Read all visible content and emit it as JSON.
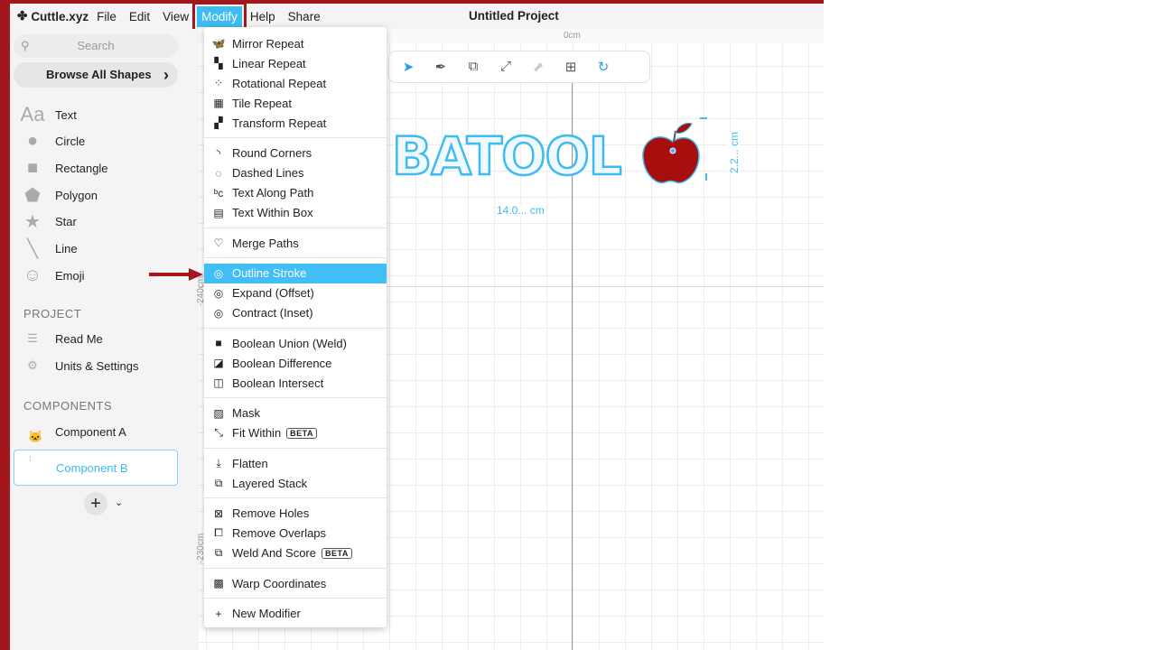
{
  "app": {
    "name": "Cuttle.xyz",
    "project_title": "Untitled Project"
  },
  "menubar": [
    "File",
    "Edit",
    "View",
    "Modify",
    "Help",
    "Share"
  ],
  "sidebar": {
    "search_placeholder": "Search",
    "browse": "Browse All Shapes",
    "shapes": [
      {
        "label": "Text",
        "icon": "text-aa-icon"
      },
      {
        "label": "Circle",
        "icon": "circle-icon"
      },
      {
        "label": "Rectangle",
        "icon": "rectangle-icon"
      },
      {
        "label": "Polygon",
        "icon": "polygon-icon"
      },
      {
        "label": "Star",
        "icon": "star-icon"
      },
      {
        "label": "Line",
        "icon": "line-icon"
      },
      {
        "label": "Emoji",
        "icon": "emoji-icon"
      }
    ],
    "project_heading": "PROJECT",
    "project_items": [
      {
        "label": "Read Me",
        "icon": "document-icon"
      },
      {
        "label": "Units & Settings",
        "icon": "gear-icon"
      }
    ],
    "components_heading": "COMPONENTS",
    "components": [
      {
        "label": "Component A",
        "selected": false
      },
      {
        "label": "Component B",
        "selected": true
      }
    ]
  },
  "canvas": {
    "ruler_zero": "0cm",
    "ruler_v1": "-240cm",
    "ruler_v2": "-230cm",
    "text": "BATOOL",
    "width_dim": "14.0... cm",
    "height_dim": "2.2... cm",
    "colors": {
      "accent": "#3ebbf0",
      "apple": "#a80e0e"
    }
  },
  "modify_menu": {
    "groups": [
      [
        {
          "label": "Mirror Repeat",
          "icon": "butterfly-icon"
        },
        {
          "label": "Linear Repeat",
          "icon": "linear-repeat-icon"
        },
        {
          "label": "Rotational Repeat",
          "icon": "rotational-repeat-icon"
        },
        {
          "label": "Tile Repeat",
          "icon": "grid-icon"
        },
        {
          "label": "Transform Repeat",
          "icon": "transform-repeat-icon"
        }
      ],
      [
        {
          "label": "Round Corners",
          "icon": "round-corner-icon"
        },
        {
          "label": "Dashed Lines",
          "icon": "dashed-circle-icon"
        },
        {
          "label": "Text Along Path",
          "icon": "text-path-icon"
        },
        {
          "label": "Text Within Box",
          "icon": "text-box-icon"
        }
      ],
      [
        {
          "label": "Merge Paths",
          "icon": "merge-icon"
        }
      ],
      [
        {
          "label": "Outline Stroke",
          "icon": "outline-icon",
          "highlighted": true
        },
        {
          "label": "Expand (Offset)",
          "icon": "expand-icon"
        },
        {
          "label": "Contract (Inset)",
          "icon": "contract-icon"
        }
      ],
      [
        {
          "label": "Boolean Union (Weld)",
          "icon": "union-icon"
        },
        {
          "label": "Boolean Difference",
          "icon": "difference-icon"
        },
        {
          "label": "Boolean Intersect",
          "icon": "intersect-icon"
        }
      ],
      [
        {
          "label": "Mask",
          "icon": "mask-icon"
        },
        {
          "label": "Fit Within",
          "icon": "fit-icon",
          "badge": "BETA"
        }
      ],
      [
        {
          "label": "Flatten",
          "icon": "flatten-icon"
        },
        {
          "label": "Layered Stack",
          "icon": "layers-icon"
        }
      ],
      [
        {
          "label": "Remove Holes",
          "icon": "remove-holes-icon"
        },
        {
          "label": "Remove Overlaps",
          "icon": "remove-overlaps-icon"
        },
        {
          "label": "Weld And Score",
          "icon": "weld-score-icon",
          "badge": "BETA"
        }
      ],
      [
        {
          "label": "Warp Coordinates",
          "icon": "warp-icon"
        }
      ],
      [
        {
          "label": "New Modifier",
          "icon": "plus-icon"
        }
      ]
    ]
  }
}
